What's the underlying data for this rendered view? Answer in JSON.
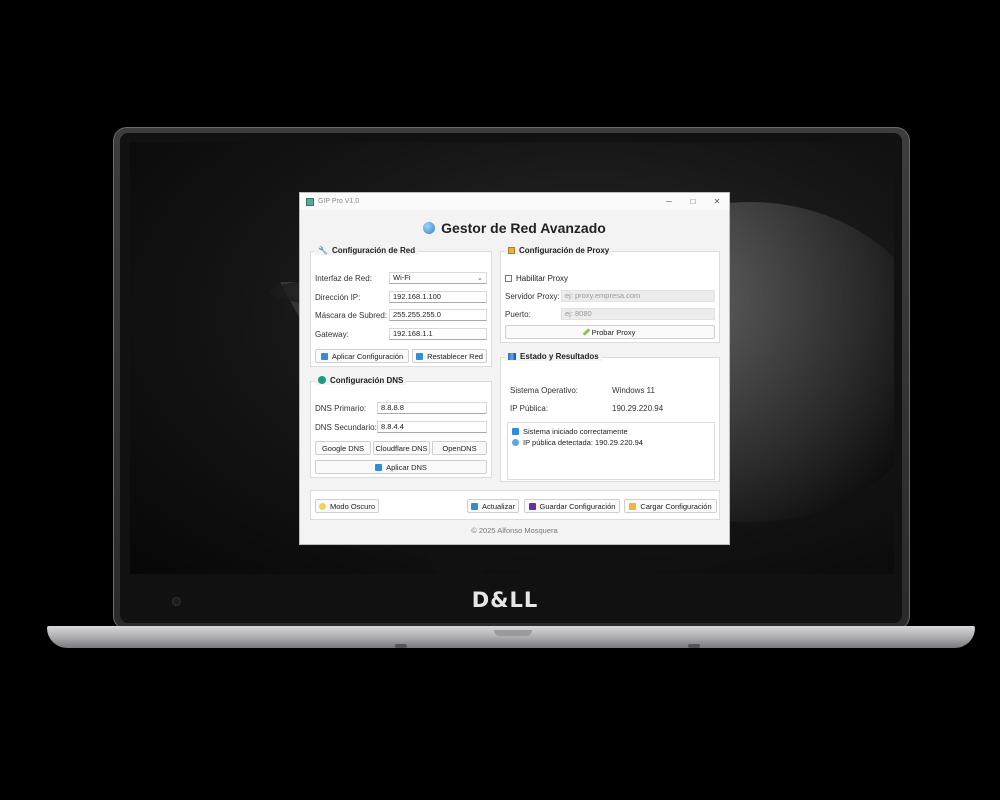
{
  "device": {
    "brand": "D&LL"
  },
  "window": {
    "title": "GIP Pro V1.0",
    "controls": {
      "minimize": "─",
      "maximize": "□",
      "close": "✕"
    },
    "heading": "Gestor de Red Avanzado"
  },
  "network": {
    "title": "Configuración de Red",
    "interface_label": "Interfaz de Red:",
    "interface_value": "Wi-Fi",
    "ip_label": "Dirección IP:",
    "ip_value": "192.168.1.100",
    "mask_label": "Máscara de Subred:",
    "mask_value": "255.255.255.0",
    "gateway_label": "Gateway:",
    "gateway_value": "192.168.1.1",
    "apply_label": "Aplicar Configuración",
    "reset_label": "Restablecer Red"
  },
  "dns": {
    "title": "Configuración DNS",
    "primary_label": "DNS Primario:",
    "primary_value": "8.8.8.8",
    "secondary_label": "DNS Secundario:",
    "secondary_value": "8.8.4.4",
    "presets": [
      "Google DNS",
      "Cloudflare DNS",
      "OpenDNS"
    ],
    "apply_label": "Aplicar DNS"
  },
  "proxy": {
    "title": "Configuración de Proxy",
    "enable_label": "Habilitar Proxy",
    "enabled": false,
    "server_label": "Servidor Proxy:",
    "server_placeholder": "ej: proxy.empresa.com",
    "port_label": "Puerto:",
    "port_placeholder": "ej: 8080",
    "test_label": "Probar Proxy"
  },
  "status": {
    "title": "Estado y Resultados",
    "os_label": "Sistema Operativo:",
    "os_value": "Windows 11",
    "ip_label": "IP Pública:",
    "ip_value": "190.29.220.94",
    "log": [
      "Sistema iniciado correctamente",
      "IP pública detectada: 190.29.220.94"
    ]
  },
  "toolbar": {
    "dark_mode_label": "Modo Oscuro",
    "refresh_label": "Actualizar",
    "save_label": "Guardar Configuración",
    "load_label": "Cargar Configuración"
  },
  "footer": "© 2025 Alfonso Mosquera"
}
